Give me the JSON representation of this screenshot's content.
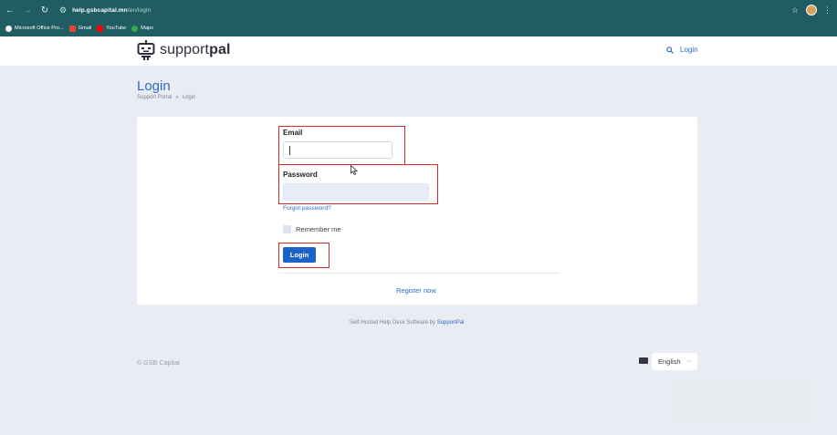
{
  "browser": {
    "url_host": "help.gsbcapital.mn",
    "url_path": "/en/login",
    "bookmarks": [
      {
        "label": "Microsoft Office Pro...",
        "color": "#ffffff"
      },
      {
        "label": "Gmail",
        "color": "#ea4335"
      },
      {
        "label": "YouTube",
        "color": "#ff0000"
      },
      {
        "label": "Maps",
        "color": "#34a853"
      }
    ]
  },
  "header": {
    "logo_text_light": "support",
    "logo_text_bold": "pal",
    "login_link": "Login"
  },
  "page": {
    "title": "Login",
    "breadcrumb": [
      "Support Portal",
      "»",
      "Login"
    ]
  },
  "form": {
    "email_label": "Email",
    "email_value": "",
    "password_label": "Password",
    "password_value": "",
    "forgot_password": "Forgot password?",
    "remember_me": "Remember me",
    "login_button": "Login",
    "register": "Register now"
  },
  "footer": {
    "powered_prefix": "Self-Hosted Help Desk Software by ",
    "powered_link": "SupportPal",
    "copyright": "© GSB Capital",
    "language": "English"
  },
  "colors": {
    "chrome": "#1f5d63",
    "accent": "#2e69c7",
    "button": "#1c62c7",
    "highlight": "#d12a2a",
    "page_bg": "#e9ecf3"
  }
}
